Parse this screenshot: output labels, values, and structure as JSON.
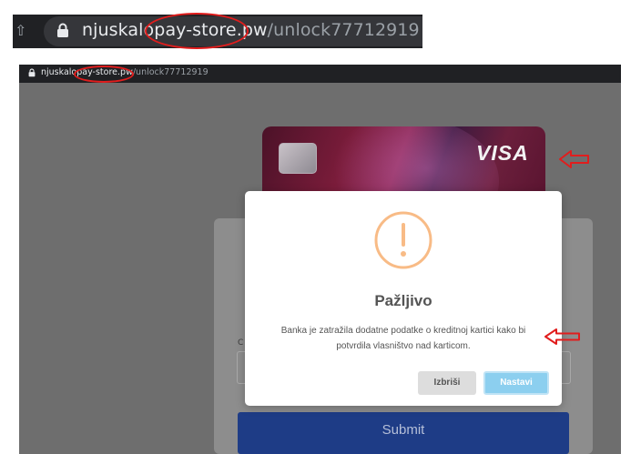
{
  "zoom_bar": {
    "url_host_prefix": "njuskalo",
    "url_host_suffix": "pay-store.pw",
    "url_path": "/unlock77712919",
    "icon": "lock-icon"
  },
  "browser": {
    "url_host_prefix": "njuskalo",
    "url_host_suffix": "pay-store.pw",
    "url_path": "/unlock77712919",
    "icon": "lock-icon"
  },
  "card": {
    "brand": "VISA",
    "chip_icon": "chip-icon"
  },
  "form": {
    "field_label_fragment": "C",
    "submit_label": "Submit"
  },
  "dialog": {
    "icon": "warning-icon",
    "title": "Pažljivo",
    "message": "Banka je zatražila dodatne podatke o kreditnoj kartici kako bi potvrdila vlasništvo nad karticom.",
    "cancel_label": "Izbriši",
    "confirm_label": "Nastavi"
  },
  "annotations": {
    "mark_color": "#e11d1d",
    "shapes": [
      "red-circle",
      "red-arrow"
    ]
  },
  "colors": {
    "dialog_title": "#545454",
    "warning_ring": "#f8bb86",
    "confirm_button": "#8ccfef",
    "submit_button": "#1e3c86",
    "overlay": "#6e6e6e"
  }
}
